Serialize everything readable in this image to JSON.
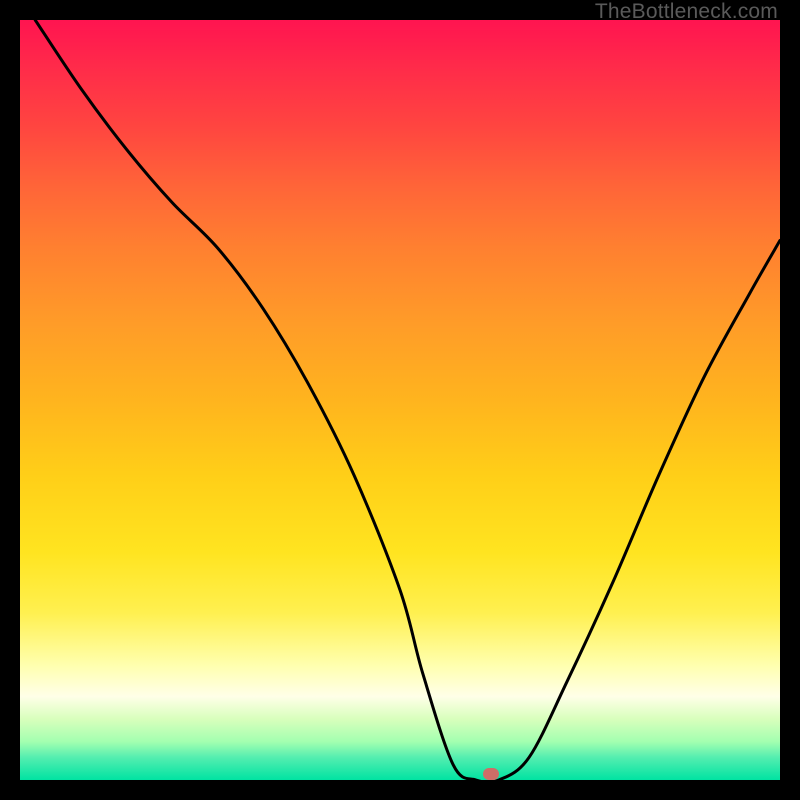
{
  "watermark": "TheBottleneck.com",
  "chart_data": {
    "type": "line",
    "title": "",
    "xlabel": "",
    "ylabel": "",
    "xlim": [
      0,
      100
    ],
    "ylim": [
      0,
      100
    ],
    "grid": false,
    "legend": false,
    "annotations": [],
    "series": [
      {
        "name": "curve",
        "x": [
          2,
          8,
          14,
          20,
          26,
          32,
          38,
          44,
          50,
          53,
          57,
          60,
          63,
          67,
          72,
          78,
          84,
          90,
          96,
          100
        ],
        "y": [
          100,
          91,
          83,
          76,
          70,
          62,
          52,
          40,
          25,
          14,
          2,
          0,
          0,
          3,
          13,
          26,
          40,
          53,
          64,
          71
        ]
      }
    ],
    "marker": {
      "x": 62,
      "y": 0.8
    }
  },
  "colors": {
    "background": "#000000",
    "curve_stroke": "#000000",
    "marker_fill": "#cf6d67"
  }
}
